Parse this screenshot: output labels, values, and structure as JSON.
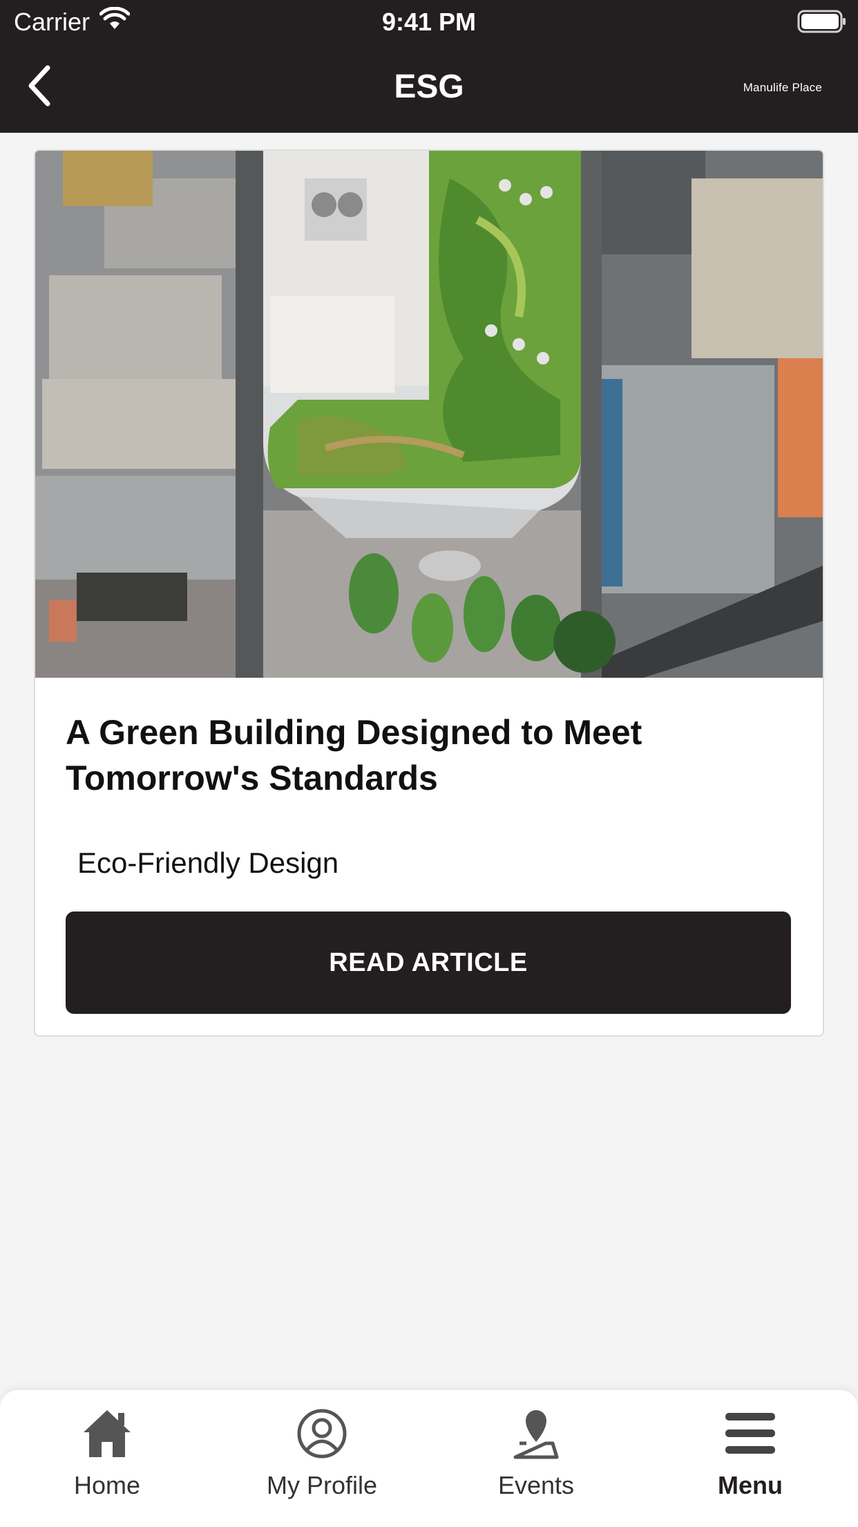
{
  "status_bar": {
    "carrier": "Carrier",
    "time": "9:41 PM",
    "icons": [
      "wifi-icon",
      "battery-icon"
    ]
  },
  "header": {
    "title": "ESG",
    "brand": "Manulife Place",
    "back_icon": "chevron-left-icon",
    "background": "#231f20"
  },
  "article": {
    "image_alt": "Aerial view of a high-rise with a landscaped green roof",
    "title": "A Green Building Designed to Meet Tomorrow's Standards",
    "tag": "Eco-Friendly Design",
    "button_label": "READ ARTICLE"
  },
  "tabbar": {
    "items": [
      {
        "label": "Home",
        "icon": "home-icon",
        "active": false
      },
      {
        "label": "My Profile",
        "icon": "profile-icon",
        "active": false
      },
      {
        "label": "Events",
        "icon": "map-pin-icon",
        "active": false
      },
      {
        "label": "Menu",
        "icon": "hamburger-menu-icon",
        "active": true
      }
    ]
  },
  "colors": {
    "dark": "#231f20",
    "page_background": "#f4f4f4",
    "card_background": "#ffffff",
    "icon_gray": "#555555"
  }
}
